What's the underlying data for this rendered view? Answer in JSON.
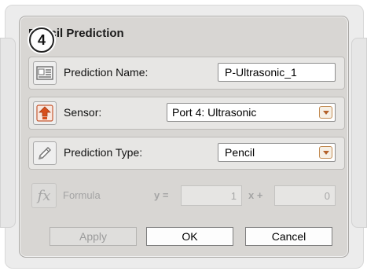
{
  "step_badge": "4",
  "dialog": {
    "title": "Pencil Prediction"
  },
  "prediction_name": {
    "label": "Prediction Name:",
    "value": "P-Ultrasonic_1"
  },
  "sensor": {
    "label": "Sensor:",
    "value": "Port 4: Ultrasonic"
  },
  "prediction_type": {
    "label": "Prediction Type:",
    "value": "Pencil"
  },
  "formula": {
    "icon_text": "fx",
    "label": "Formula",
    "y_text": "y =",
    "slope": "1",
    "x_text": "x +",
    "intercept": "0"
  },
  "buttons": {
    "apply": "Apply",
    "ok": "OK",
    "cancel": "Cancel"
  },
  "colors": {
    "accent_orange": "#d84f1c",
    "combo_arrow": "#b4622b"
  }
}
